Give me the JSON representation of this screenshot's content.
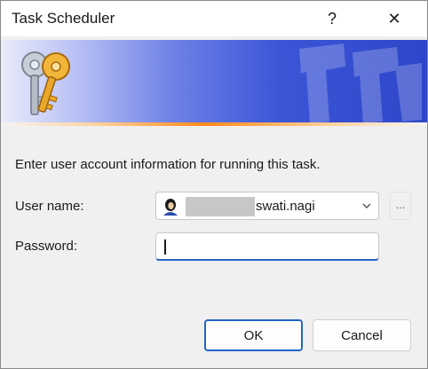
{
  "window": {
    "title": "Task Scheduler",
    "help_glyph": "?",
    "close_glyph": "✕"
  },
  "banner": {
    "icon": "keys-icon",
    "gradient_colors": [
      "#e9ecfb",
      "#6f82e6",
      "#2e46c9"
    ],
    "stripe_color": "#ff8a1c"
  },
  "form": {
    "instruction": "Enter user account information for running this task.",
    "username_label": "User name:",
    "username_value": "swati.nagi",
    "browse_label": "...",
    "password_label": "Password:",
    "password_value": ""
  },
  "buttons": {
    "ok": "OK",
    "cancel": "Cancel"
  },
  "colors": {
    "accent": "#2364c7"
  }
}
